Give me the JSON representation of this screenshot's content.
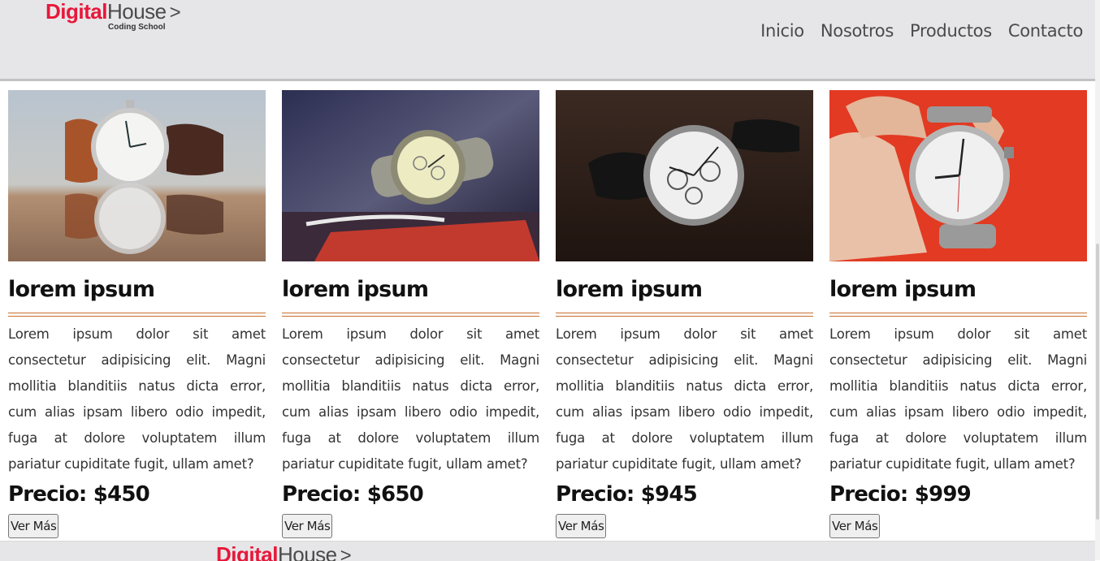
{
  "header": {
    "logo": {
      "digital": "Digital",
      "house": "House",
      "chevron": ">",
      "subtitle": "Coding School"
    },
    "nav": [
      "Inicio",
      "Nosotros",
      "Productos",
      "Contacto"
    ]
  },
  "colors": {
    "brand_red": "#e8173a",
    "header_bg": "#e6e6e8",
    "rule": "#c9702e"
  },
  "products": [
    {
      "image": "watch-leather-strap-reflection",
      "title": "lorem ipsum",
      "text": "Lorem ipsum dolor sit amet consectetur adipisicing elit. Magni mollitia blanditiis natus dicta error, cum alias ipsam libero odio impedit, fuga at dolore voluptatem illum pariatur cupiditate fugit, ullam amet?",
      "price": "Precio: $450",
      "button": "Ver Más"
    },
    {
      "image": "watch-metal-bracelet-desk",
      "title": "lorem ipsum",
      "text": "Lorem ipsum dolor sit amet consectetur adipisicing elit. Magni mollitia blanditiis natus dicta error, cum alias ipsam libero odio impedit, fuga at dolore voluptatem illum pariatur cupiditate fugit, ullam amet?",
      "price": "Precio: $650",
      "button": "Ver Más"
    },
    {
      "image": "watch-chronograph-wood",
      "title": "lorem ipsum",
      "text": "Lorem ipsum dolor sit amet consectetur adipisicing elit. Magni mollitia blanditiis natus dicta error, cum alias ipsam libero odio impedit, fuga at dolore voluptatem illum pariatur cupiditate fugit, ullam amet?",
      "price": "Precio: $945",
      "button": "Ver Más"
    },
    {
      "image": "watch-in-hand-red",
      "title": "lorem ipsum",
      "text": "Lorem ipsum dolor sit amet consectetur adipisicing elit. Magni mollitia blanditiis natus dicta error, cum alias ipsam libero odio impedit, fuga at dolore voluptatem illum pariatur cupiditate fugit, ullam amet?",
      "price": "Precio: $999",
      "button": "Ver Más"
    }
  ],
  "footer": {
    "logo": {
      "digital": "Digital",
      "house": "House",
      "chevron": ">"
    }
  }
}
